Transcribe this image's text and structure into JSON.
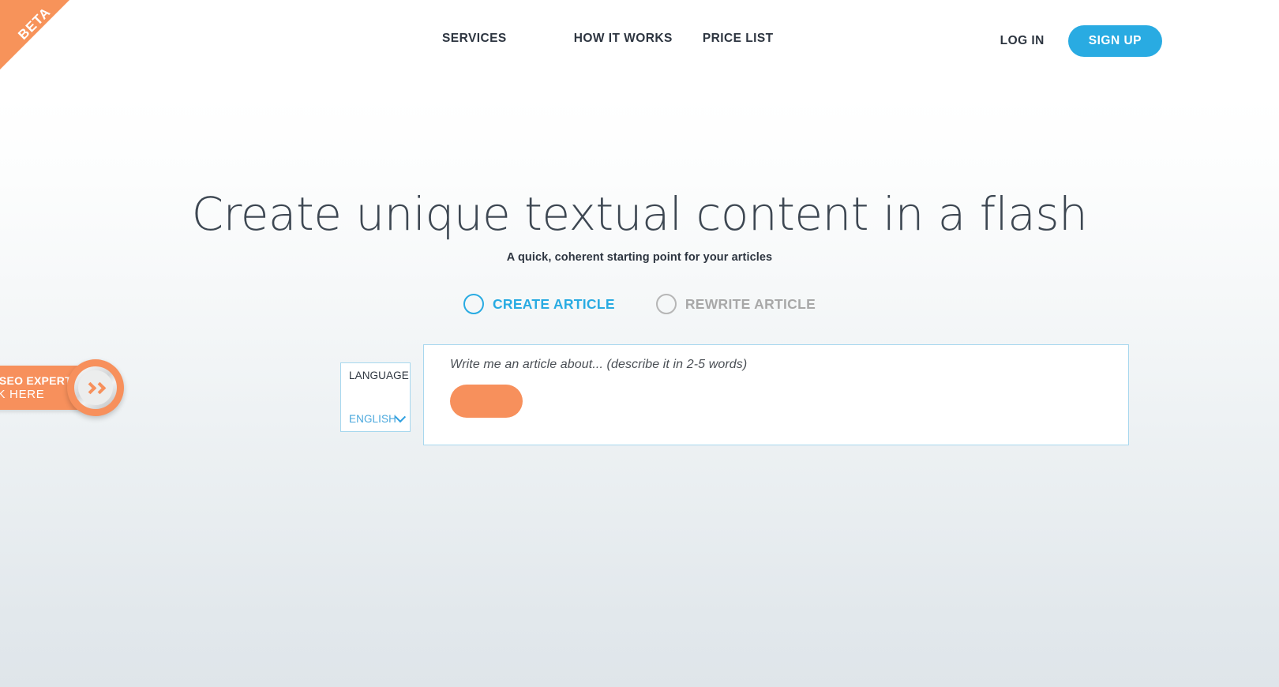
{
  "ribbon": {
    "label": "BETA"
  },
  "header": {
    "nav": [
      {
        "label": "SERVICES",
        "name": "nav-services"
      },
      {
        "label": "HOW IT WORKS",
        "name": "nav-how-it-works"
      },
      {
        "label": "PRICE LIST",
        "name": "nav-price-list"
      }
    ],
    "login_label": "LOG IN",
    "signup_label": "SIGN UP",
    "signup_color": "#29abe2"
  },
  "hero": {
    "title": "Create unique textual content in a flash",
    "subtitle": "A quick, coherent starting point for your articles"
  },
  "modes": {
    "create": {
      "label": "CREATE ARTICLE",
      "selected": true,
      "color": "#29abe2"
    },
    "rewrite": {
      "label": "REWRITE ARTICLE",
      "selected": false,
      "color": "#a8a8a8"
    }
  },
  "language": {
    "label": "LANGUAGE",
    "value": "ENGLISH",
    "options": [
      "ENGLISH"
    ],
    "accent": "#4aa8dd"
  },
  "composer": {
    "placeholder": "Write me an article about... (describe it in 2-5 words)",
    "value": "",
    "submit_label": "",
    "submit_color": "#f7905c",
    "border_color": "#a7d7ee"
  },
  "promo": {
    "line1": "GENCIES & SEO EXPERTS",
    "line2": "CLICK HERE",
    "color": "#f7905c",
    "arrow_icon": "double-chevron-right-icon"
  }
}
